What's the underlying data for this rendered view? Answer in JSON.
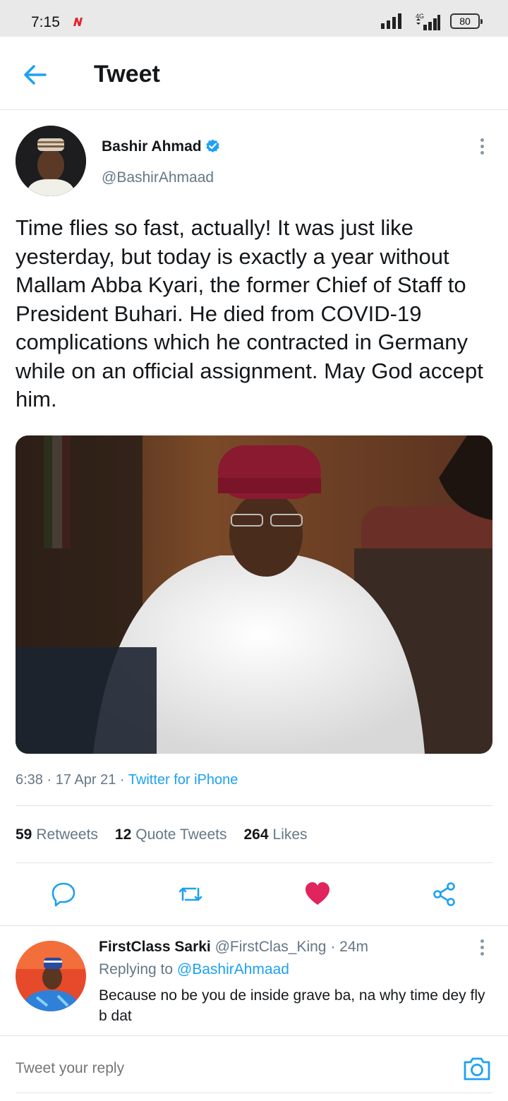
{
  "status_bar": {
    "time": "7:15",
    "network_type": "4G",
    "battery_level": "80",
    "notification_icon": "n-news-icon"
  },
  "header": {
    "title": "Tweet",
    "back_icon": "arrow-left-icon"
  },
  "tweet": {
    "author_name": "Bashir Ahmad",
    "author_handle": "@BashirAhmaad",
    "verified": true,
    "text": "Time flies so fast, actually! It was just like yesterday, but today is exactly a year without Mallam Abba Kyari, the former Chief of Staff to President Buhari. He died from COVID-19 complications which he contracted in Germany while on an official assignment. May God accept him.",
    "time": "6:38",
    "date": "17 Apr 21",
    "source": "Twitter for iPhone"
  },
  "stats": {
    "retweets_count": "59",
    "retweets_label": "Retweets",
    "quotes_count": "12",
    "quotes_label": "Quote Tweets",
    "likes_count": "264",
    "likes_label": "Likes"
  },
  "actions": [
    "reply-icon",
    "retweet-icon",
    "like-icon",
    "share-icon"
  ],
  "reply": {
    "author_name": "FirstClass Sarki",
    "author_handle": "@FirstClas_King",
    "time": "24m",
    "replying_prefix": "Replying to",
    "replying_to": "@BashirAhmaad",
    "text": "Because no be you de inside grave ba, na why time dey fly b dat"
  },
  "compose": {
    "placeholder": "Tweet your reply",
    "camera_icon": "camera-icon"
  },
  "colors": {
    "accent": "#1da1f2",
    "like": "#e0245e",
    "secondary_text": "#657786",
    "divider": "#dfe3e6"
  }
}
